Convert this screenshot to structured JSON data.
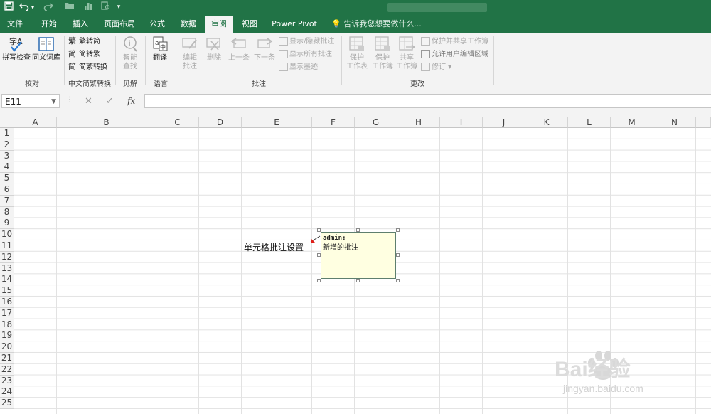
{
  "quick_access": {
    "save_icon": "save-icon",
    "undo_icon": "undo-icon",
    "redo_icon": "redo-icon"
  },
  "tabs": [
    {
      "label": "文件",
      "active": false
    },
    {
      "label": "开始",
      "active": false
    },
    {
      "label": "插入",
      "active": false
    },
    {
      "label": "页面布局",
      "active": false
    },
    {
      "label": "公式",
      "active": false
    },
    {
      "label": "数据",
      "active": false
    },
    {
      "label": "审阅",
      "active": true
    },
    {
      "label": "视图",
      "active": false
    },
    {
      "label": "Power Pivot",
      "active": false
    }
  ],
  "tell_me": "告诉我您想要做什么...",
  "ribbon": {
    "proofing": {
      "spell": "拼写检查",
      "thesaurus": "同义词库",
      "label": "校对"
    },
    "chinese": {
      "to_trad": "繁转简",
      "to_simp": "简转繁",
      "convert": "简繁转换",
      "label": "中文简繁转换"
    },
    "insights": {
      "smart_lookup_1": "智能",
      "smart_lookup_2": "查找",
      "label": "见解"
    },
    "language": {
      "translate": "翻译",
      "label": "语言"
    },
    "comments": {
      "edit_1": "编辑",
      "edit_2": "批注",
      "delete": "删除",
      "prev": "上一条",
      "next": "下一条",
      "show_hide": "显示/隐藏批注",
      "show_all": "显示所有批注",
      "show_ink": "显示墨迹",
      "label": "批注"
    },
    "changes": {
      "protect_sheet_1": "保护",
      "protect_sheet_2": "工作表",
      "protect_wb_1": "保护",
      "protect_wb_2": "工作簿",
      "share_wb_1": "共享",
      "share_wb_2": "工作簿",
      "protect_share": "保护并共享工作簿",
      "allow_edit": "允许用户编辑区域",
      "track": "修订",
      "label": "更改"
    }
  },
  "formula_bar": {
    "name_box": "E11",
    "fx": "fx",
    "value": ""
  },
  "columns": [
    "A",
    "B",
    "C",
    "D",
    "E",
    "F",
    "G",
    "H",
    "I",
    "J",
    "K",
    "L",
    "M",
    "N"
  ],
  "rows": [
    "1",
    "2",
    "3",
    "4",
    "5",
    "6",
    "7",
    "8",
    "9",
    "10",
    "11",
    "12",
    "13",
    "14",
    "15",
    "16",
    "17",
    "18",
    "19",
    "20",
    "21",
    "22",
    "23",
    "24",
    "25"
  ],
  "cell_E11": "单元格批注设置",
  "comment": {
    "author": "admin:",
    "text": "新增的批注"
  },
  "watermark": {
    "brand": "Bai经验",
    "url": "jingyan.baidu.com"
  },
  "colors": {
    "accent": "#217346",
    "comment_bg": "#ffffe1"
  }
}
